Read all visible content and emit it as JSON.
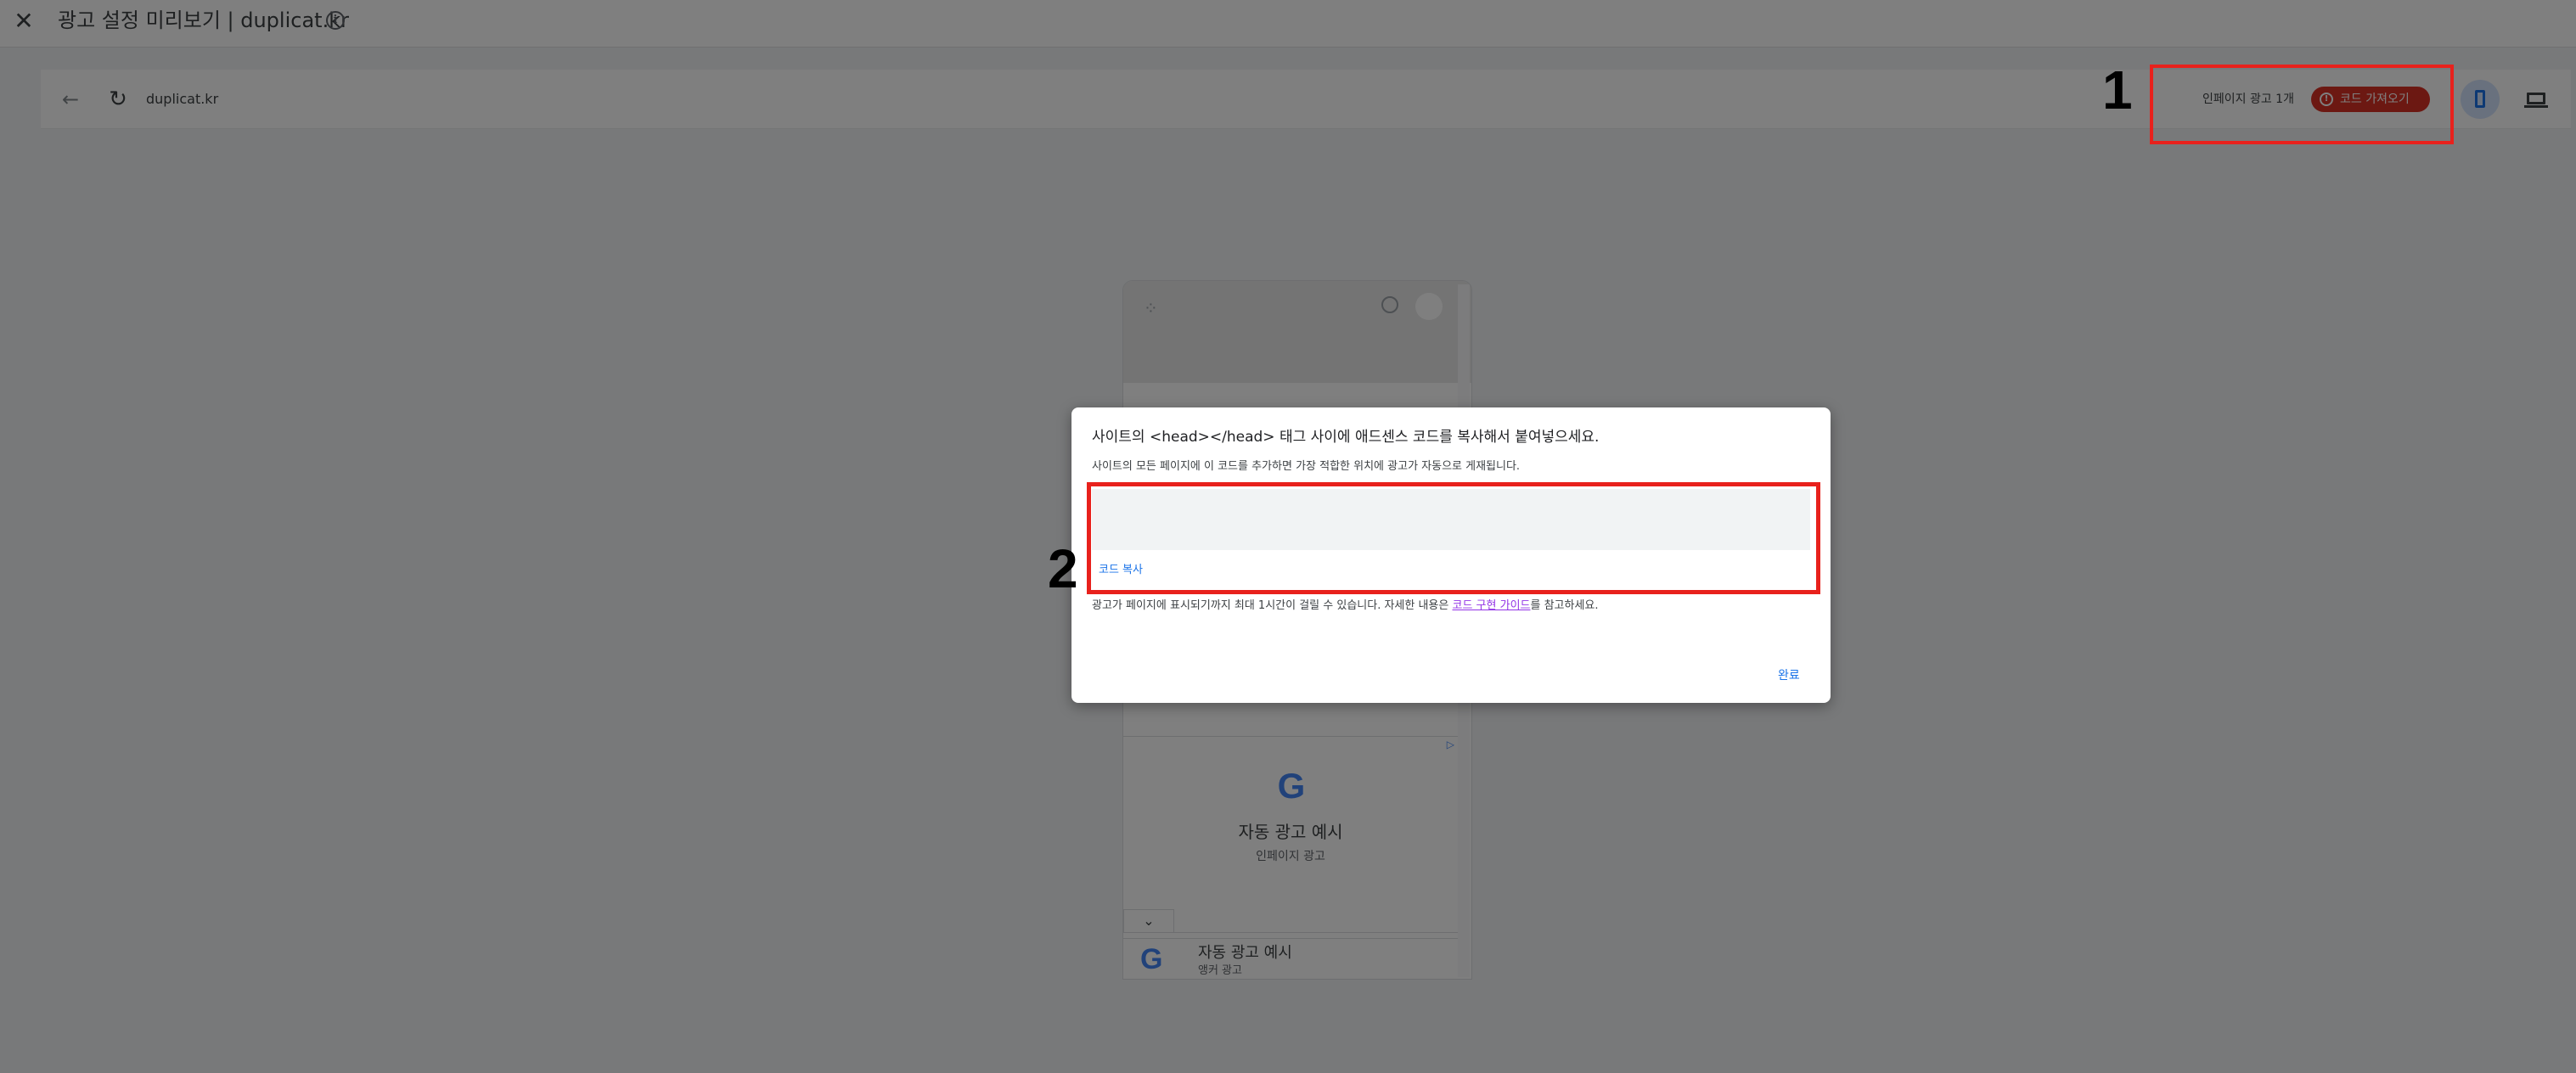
{
  "header": {
    "title": "광고 설정 미리보기 | duplicat.kr",
    "close_icon": "close-icon",
    "info_icon": "info-icon"
  },
  "urlbar": {
    "url": "duplicat.kr",
    "back_icon": "arrow-back-icon",
    "reload_icon": "refresh-icon"
  },
  "status": {
    "ad_count": "인페이지 광고 1개",
    "get_code_label": "코드 가져오기",
    "warning_icon": "warning-circle-icon",
    "pill_color": "#d93025"
  },
  "devices": {
    "mobile_icon": "smartphone-icon",
    "desktop_icon": "laptop-icon",
    "selected": "mobile"
  },
  "preview": {
    "big_ad_title": "자동 광고 예시",
    "big_ad_subtitle": "인페이지 광고",
    "anchor_ad_title": "자동 광고 예시",
    "anchor_ad_subtitle": "앵커 광고"
  },
  "dialog": {
    "title": "사이트의 <head></head> 태그 사이에 애드센스 코드를 복사해서 붙여넣으세요.",
    "description": "사이트의 모든 페이지에 이 코드를 추가하면 가장 적합한 위치에 광고가 자동으로 게재됩니다.",
    "code": "",
    "copy_label": "코드 복사",
    "note_before": "광고가 페이지에 표시되기까지 최대 1시간이 걸릴 수 있습니다. 자세한 내용은 ",
    "note_link": "코드 구현 가이드",
    "note_after": "를 참고하세요.",
    "done_label": "완료",
    "link_color": "#1a73e8"
  },
  "annotations": {
    "marker_1": "1",
    "marker_2": "2",
    "box_color": "#e8211c"
  }
}
